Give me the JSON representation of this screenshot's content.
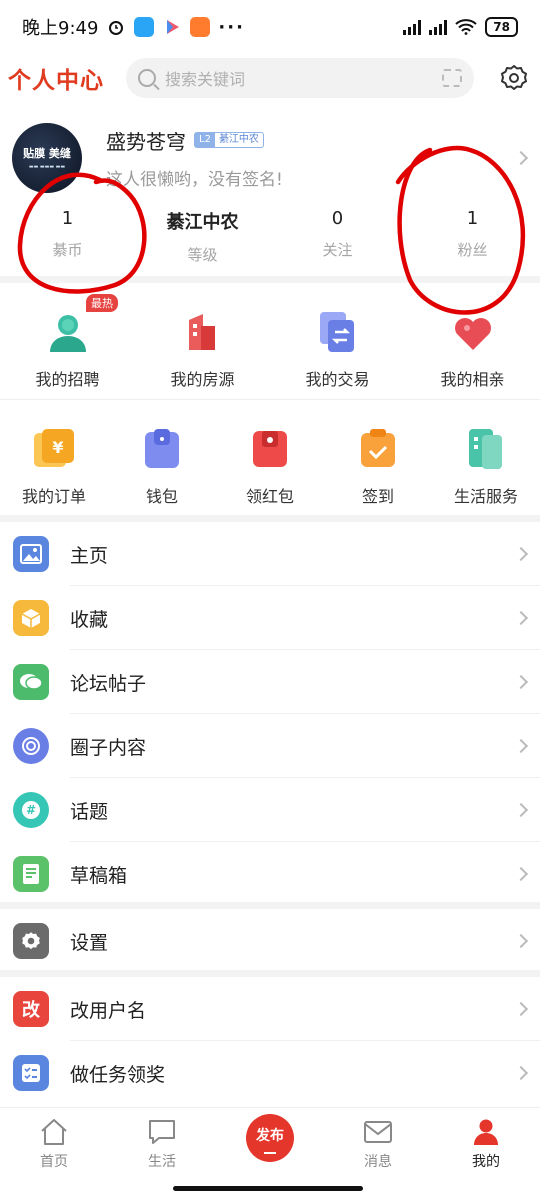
{
  "status_bar": {
    "time": "晚上9:49",
    "battery": "78"
  },
  "header": {
    "title": "个人中心",
    "search_placeholder": "搜索关键词"
  },
  "profile": {
    "name": "盛势苍穹",
    "level_badge": "L2",
    "level_name": "綦江中农",
    "signature": "这人很懒哟，没有签名!",
    "avatar_text": "贴膜 美缝"
  },
  "stats": [
    {
      "value": "1",
      "label": "綦币"
    },
    {
      "value": "綦江中农",
      "label": "等级"
    },
    {
      "value": "0",
      "label": "关注"
    },
    {
      "value": "1",
      "label": "粉丝"
    }
  ],
  "features": {
    "hot_badge": "最热",
    "items": [
      {
        "label": "我的招聘",
        "icon": "person-icon"
      },
      {
        "label": "我的房源",
        "icon": "building-icon"
      },
      {
        "label": "我的交易",
        "icon": "exchange-icon"
      },
      {
        "label": "我的相亲",
        "icon": "heart-icon"
      }
    ]
  },
  "services": [
    {
      "label": "我的订单",
      "icon": "yuan-order-icon"
    },
    {
      "label": "钱包",
      "icon": "wallet-icon"
    },
    {
      "label": "领红包",
      "icon": "red-packet-icon"
    },
    {
      "label": "签到",
      "icon": "checkin-icon"
    },
    {
      "label": "生活服务",
      "icon": "life-service-icon"
    }
  ],
  "menu_group1": [
    {
      "label": "主页",
      "icon": "image-icon",
      "color": "#5b86e0"
    },
    {
      "label": "收藏",
      "icon": "box-icon",
      "color": "#f6b93b"
    },
    {
      "label": "论坛帖子",
      "icon": "chat-icon",
      "color": "#4cbb6c"
    },
    {
      "label": "圈子内容",
      "icon": "circle-icon",
      "color": "#6a7fe6"
    },
    {
      "label": "话题",
      "icon": "hashtag-icon",
      "color": "#36c6b5"
    },
    {
      "label": "草稿箱",
      "icon": "draft-icon",
      "color": "#5cc26a"
    }
  ],
  "menu_group2": [
    {
      "label": "设置",
      "icon": "gear-icon",
      "color": "#6b6b6b"
    }
  ],
  "menu_group3": [
    {
      "label": "改用户名",
      "icon": "rename-icon",
      "color": "#e8453c",
      "glyph": "改"
    },
    {
      "label": "做任务领奖",
      "icon": "task-icon",
      "color": "#5b86e0"
    }
  ],
  "tabbar": {
    "items": [
      {
        "label": "首页"
      },
      {
        "label": "生活"
      },
      {
        "label": "发布"
      },
      {
        "label": "消息"
      },
      {
        "label": "我的"
      }
    ]
  },
  "colors": {
    "accent": "#e5362b",
    "annotation": "#e00000"
  }
}
